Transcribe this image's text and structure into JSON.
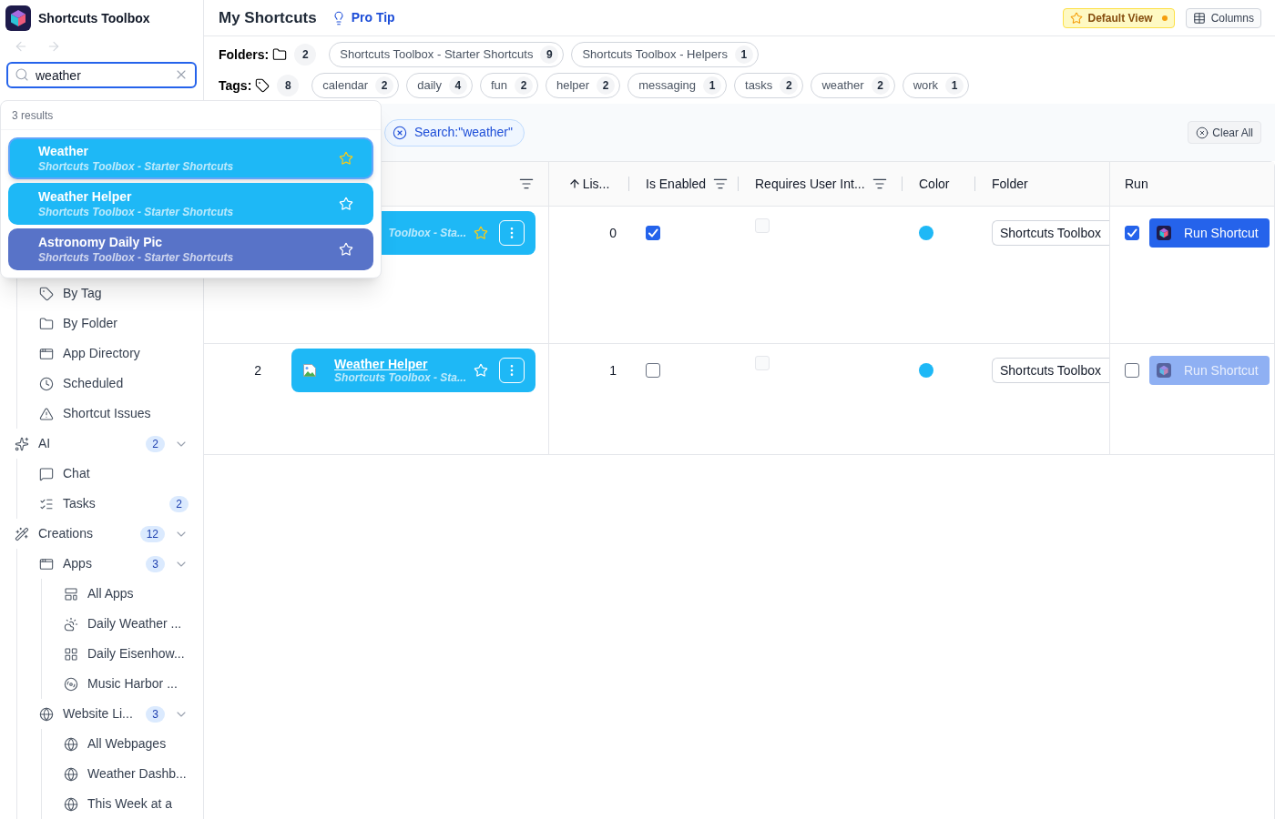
{
  "app": {
    "title": "Shortcuts Toolbox"
  },
  "search": {
    "value": "weather"
  },
  "search_results": {
    "count_label": "3 results",
    "items": [
      {
        "title": "Weather",
        "subtitle": "Shortcuts Toolbox - Starter Shortcuts",
        "color": "#1eb8f6",
        "favorite": true,
        "selected": true
      },
      {
        "title": "Weather Helper",
        "subtitle": "Shortcuts Toolbox - Starter Shortcuts",
        "color": "#1eb8f6",
        "favorite": false,
        "selected": false
      },
      {
        "title": "Astronomy Daily Pic",
        "subtitle": "Shortcuts Toolbox - Starter Shortcuts",
        "color": "#5873c8",
        "favorite": false,
        "selected": false
      }
    ]
  },
  "sidebar": {
    "items": [
      {
        "children": [
          {
            "label": "By Tag"
          },
          {
            "label": "By Folder"
          },
          {
            "label": "App Directory"
          },
          {
            "label": "Scheduled"
          },
          {
            "label": "Shortcut Issues"
          }
        ]
      },
      {
        "label": "AI",
        "badge": "2",
        "expanded": true,
        "children": [
          {
            "label": "Chat"
          },
          {
            "label": "Tasks",
            "badge": "2"
          }
        ]
      },
      {
        "label": "Creations",
        "badge": "12",
        "expanded": true,
        "children": [
          {
            "label": "Apps",
            "badge": "3",
            "expanded": true,
            "children": [
              {
                "label": "All Apps"
              },
              {
                "label": "Daily Weather ..."
              },
              {
                "label": "Daily Eisenhow..."
              },
              {
                "label": "Music Harbor ..."
              }
            ]
          },
          {
            "label": "Website Li...",
            "badge": "3",
            "expanded": true,
            "children": [
              {
                "label": "All Webpages"
              },
              {
                "label": "Weather Dashb..."
              },
              {
                "label": "This Week at a"
              }
            ]
          }
        ]
      }
    ]
  },
  "header": {
    "title": "My Shortcuts",
    "pro_tip": "Pro Tip",
    "default_view": {
      "label": "Default View",
      "modified": true
    },
    "columns_button": "Columns"
  },
  "folders": {
    "label": "Folders:",
    "count": "2",
    "items": [
      {
        "name": "Shortcuts Toolbox - Starter Shortcuts",
        "count": "9"
      },
      {
        "name": "Shortcuts Toolbox - Helpers",
        "count": "1"
      }
    ]
  },
  "tags": {
    "label": "Tags:",
    "count": "8",
    "items": [
      {
        "name": "calendar",
        "count": "2"
      },
      {
        "name": "daily",
        "count": "4"
      },
      {
        "name": "fun",
        "count": "2"
      },
      {
        "name": "helper",
        "count": "2"
      },
      {
        "name": "messaging",
        "count": "1"
      },
      {
        "name": "tasks",
        "count": "2"
      },
      {
        "name": "weather",
        "count": "2"
      },
      {
        "name": "work",
        "count": "1"
      }
    ]
  },
  "filter_bar": {
    "chips": [
      {
        "label": "Search:\"weather\""
      }
    ],
    "clear_all": "Clear All"
  },
  "table": {
    "columns": [
      {
        "kind": "number"
      },
      {
        "kind": "name",
        "filter": true
      },
      {
        "kind": "index",
        "label": "Lis...",
        "sorted_ascending": true,
        "filter": false
      },
      {
        "kind": "enabled",
        "label": "Is Enabled",
        "filter": true
      },
      {
        "kind": "user_input",
        "label": "Requires User Int...",
        "filter": true
      },
      {
        "kind": "color",
        "label": "Color",
        "filter": false
      },
      {
        "kind": "folder",
        "label": "Folder",
        "filter": false
      },
      {
        "kind": "run",
        "label": "Run",
        "filter": false
      }
    ],
    "rows": [
      {
        "card": {
          "subtitle": "Toolbox - Sta...",
          "favorite": true,
          "has_image": false
        },
        "list_index": "0",
        "enabled": true,
        "requires_user_input": false,
        "color": "#1eb8f6",
        "folder": "Shortcuts Toolbox",
        "run_checked": true,
        "run_button": {
          "label": "Run Shortcut",
          "disabled": false
        }
      },
      {
        "number": "2",
        "card": {
          "title": "Weather Helper",
          "subtitle": "Shortcuts Toolbox - Sta...",
          "favorite": false,
          "has_image": true
        },
        "list_index": "1",
        "enabled": false,
        "requires_user_input": false,
        "color": "#1eb8f6",
        "folder": "Shortcuts Toolbox",
        "run_checked": false,
        "run_button": {
          "label": "Run Shortcut",
          "disabled": true
        }
      }
    ]
  }
}
